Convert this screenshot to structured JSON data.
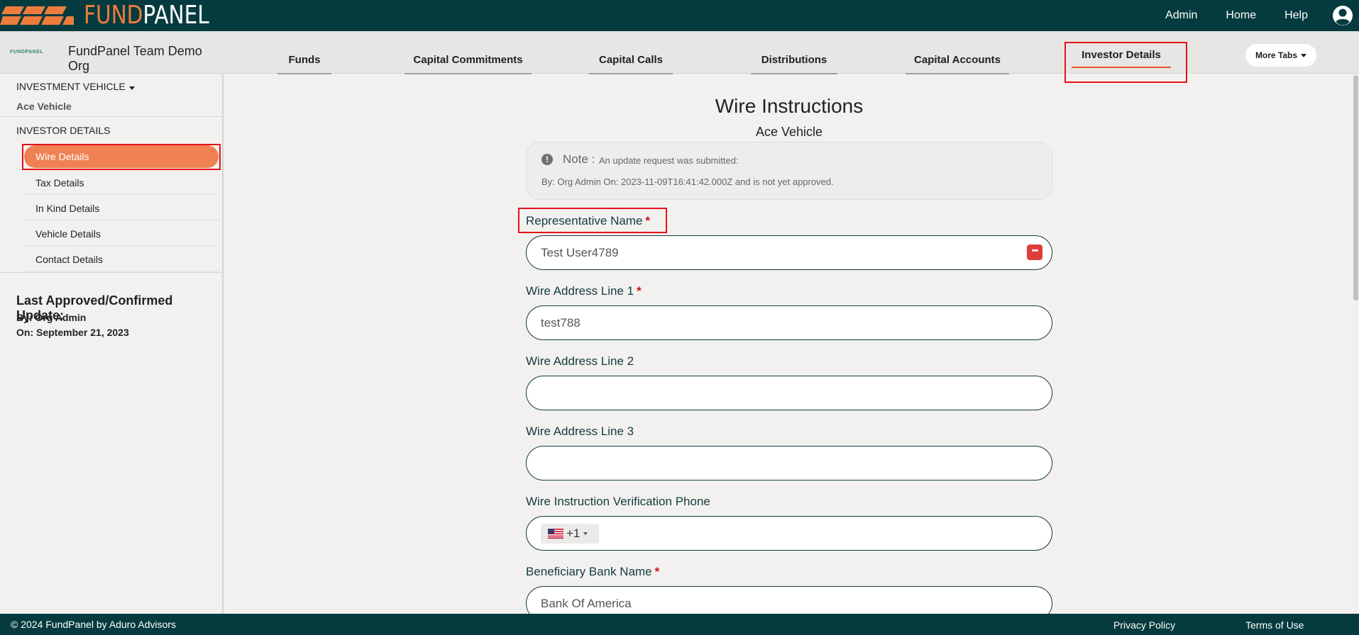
{
  "brand": {
    "fund": "FUND",
    "panel": "PANEL"
  },
  "top_nav": {
    "admin": "Admin",
    "home": "Home",
    "help": "Help"
  },
  "org": {
    "mini_logo": "FUNDPANEL",
    "name": "FundPanel Team Demo Org"
  },
  "tabs": [
    {
      "label": "Funds"
    },
    {
      "label": "Capital Commitments"
    },
    {
      "label": "Capital Calls"
    },
    {
      "label": "Distributions"
    },
    {
      "label": "Capital Accounts"
    },
    {
      "label": "Investor Details",
      "active": true
    }
  ],
  "more_tabs": "More Tabs",
  "sidebar": {
    "vehicle_heading": "INVESTMENT VEHICLE",
    "vehicle_name": "Ace Vehicle",
    "section_heading": "INVESTOR DETAILS",
    "items": [
      {
        "label": "Wire Details",
        "active": true
      },
      {
        "label": "Tax Details"
      },
      {
        "label": "In Kind Details"
      },
      {
        "label": "Vehicle Details"
      },
      {
        "label": "Contact Details"
      }
    ],
    "last_update_title": "Last Approved/Confirmed Update:",
    "last_update_by": "By: Org Admin",
    "last_update_on": "On: September 21, 2023"
  },
  "main": {
    "title": "Wire Instructions",
    "subtitle": "Ace Vehicle",
    "note": {
      "label": "Note :",
      "line1": "An update request was submitted:",
      "line2": "By: Org Admin On: 2023-11-09T16:41:42.000Z and is not yet approved."
    },
    "fields": {
      "rep_name": {
        "label": "Representative Name",
        "value": "Test User4789",
        "required": "*"
      },
      "addr1": {
        "label": "Wire Address Line 1",
        "value": "test788",
        "required": "*"
      },
      "addr2": {
        "label": "Wire Address Line 2",
        "value": ""
      },
      "addr3": {
        "label": "Wire Address Line 3",
        "value": ""
      },
      "phone": {
        "label": "Wire Instruction Verification Phone",
        "country_code": "+1"
      },
      "bank": {
        "label": "Beneficiary Bank Name",
        "value": "Bank Of America",
        "required": "*"
      }
    },
    "password_icon_text": "•••"
  },
  "footer": {
    "copyright": "© 2024 FundPanel by Aduro Advisors",
    "privacy": "Privacy Policy",
    "terms": "Terms of Use"
  },
  "colors": {
    "header_bg": "#053b3e",
    "accent_orange": "#ef8153",
    "highlight_red": "#e3131b"
  }
}
